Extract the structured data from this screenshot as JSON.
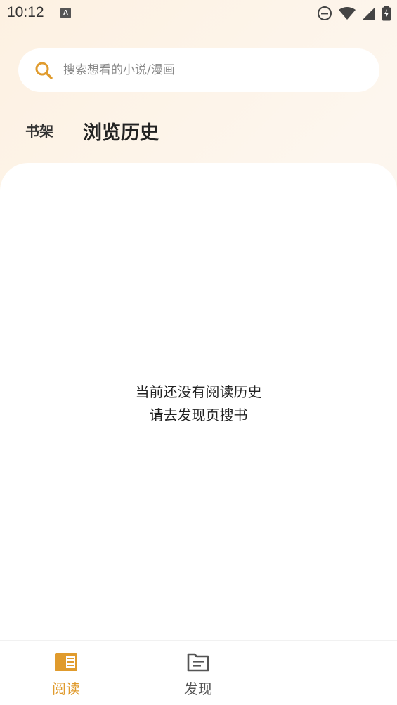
{
  "status_bar": {
    "time": "10:12",
    "notification_icon": "a-icon",
    "icons": [
      "dnd-icon",
      "wifi-icon",
      "signal-icon",
      "battery-charging-icon"
    ]
  },
  "search": {
    "placeholder": "搜索想看的小说/漫画",
    "value": "",
    "icon": "search-icon"
  },
  "tabs": [
    {
      "label": "书架",
      "active": false
    },
    {
      "label": "浏览历史",
      "active": true
    }
  ],
  "empty_state": {
    "line1": "当前还没有阅读历史",
    "line2": "请去发现页搜书"
  },
  "bottom_nav": {
    "items": [
      {
        "label": "阅读",
        "icon": "book-icon",
        "active": true
      },
      {
        "label": "发现",
        "icon": "discover-icon",
        "active": false
      }
    ]
  },
  "colors": {
    "accent": "#E09B2D",
    "inactive": "#555555",
    "background_tint": "#FDF3E6"
  }
}
